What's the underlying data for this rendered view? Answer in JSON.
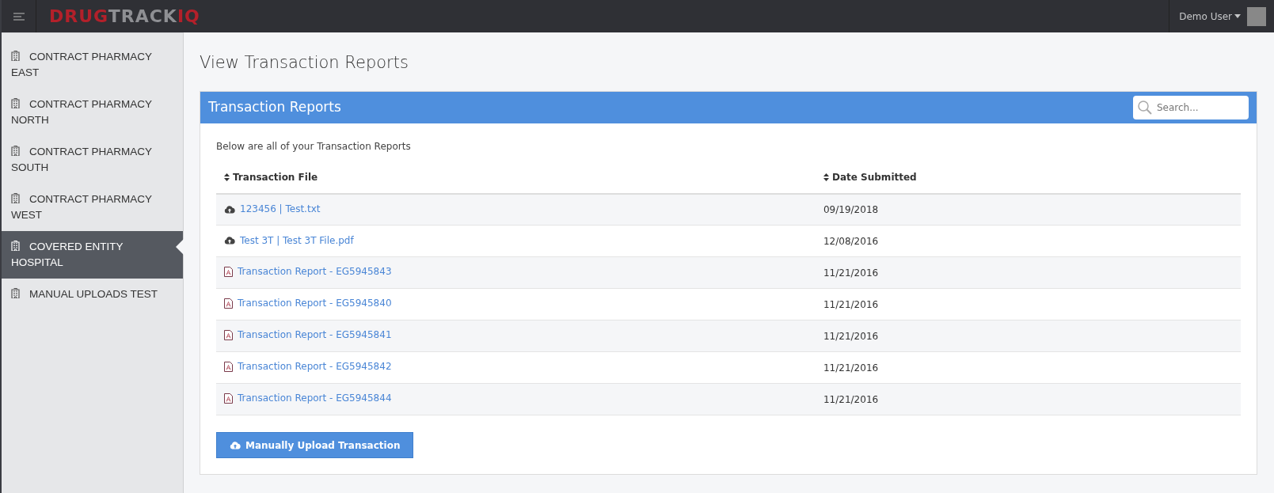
{
  "topbar": {
    "logo": [
      {
        "text": "DRUG",
        "kind": "accent"
      },
      {
        "text": "TRACK",
        "kind": "plain"
      },
      {
        "text": "IQ",
        "kind": "accent"
      }
    ],
    "user": "Demo User"
  },
  "sidebar": {
    "items": [
      {
        "label": "CONTRACT PHARMACY EAST",
        "selected": false
      },
      {
        "label": "CONTRACT PHARMACY NORTH",
        "selected": false
      },
      {
        "label": "CONTRACT PHARMACY SOUTH",
        "selected": false
      },
      {
        "label": "CONTRACT PHARMACY WEST",
        "selected": false
      },
      {
        "label": "COVERED ENTITY HOSPITAL",
        "selected": true
      },
      {
        "label": "MANUAL UPLOADS TEST",
        "selected": false
      }
    ]
  },
  "page_title": "View Transaction Reports",
  "panel": {
    "title": "Transaction Reports",
    "search": {
      "placeholder": "Search..."
    },
    "intro": "Below are all of your Transaction Reports",
    "table": {
      "columns": [
        "Transaction File",
        "Date Submitted"
      ],
      "rows": [
        {
          "kind": "upload",
          "file": "123456 | Test.txt",
          "date": "09/19/2018"
        },
        {
          "kind": "upload",
          "file": "Test 3T | Test 3T File.pdf",
          "date": "12/08/2016"
        },
        {
          "kind": "pdf",
          "file": "Transaction Report - EG5945843",
          "date": "11/21/2016"
        },
        {
          "kind": "pdf",
          "file": "Transaction Report - EG5945840",
          "date": "11/21/2016"
        },
        {
          "kind": "pdf",
          "file": "Transaction Report - EG5945841",
          "date": "11/21/2016"
        },
        {
          "kind": "pdf",
          "file": "Transaction Report - EG5945842",
          "date": "11/21/2016"
        },
        {
          "kind": "pdf",
          "file": "Transaction Report - EG5945844",
          "date": "11/21/2016"
        }
      ]
    },
    "button": "Manually Upload Transaction"
  }
}
